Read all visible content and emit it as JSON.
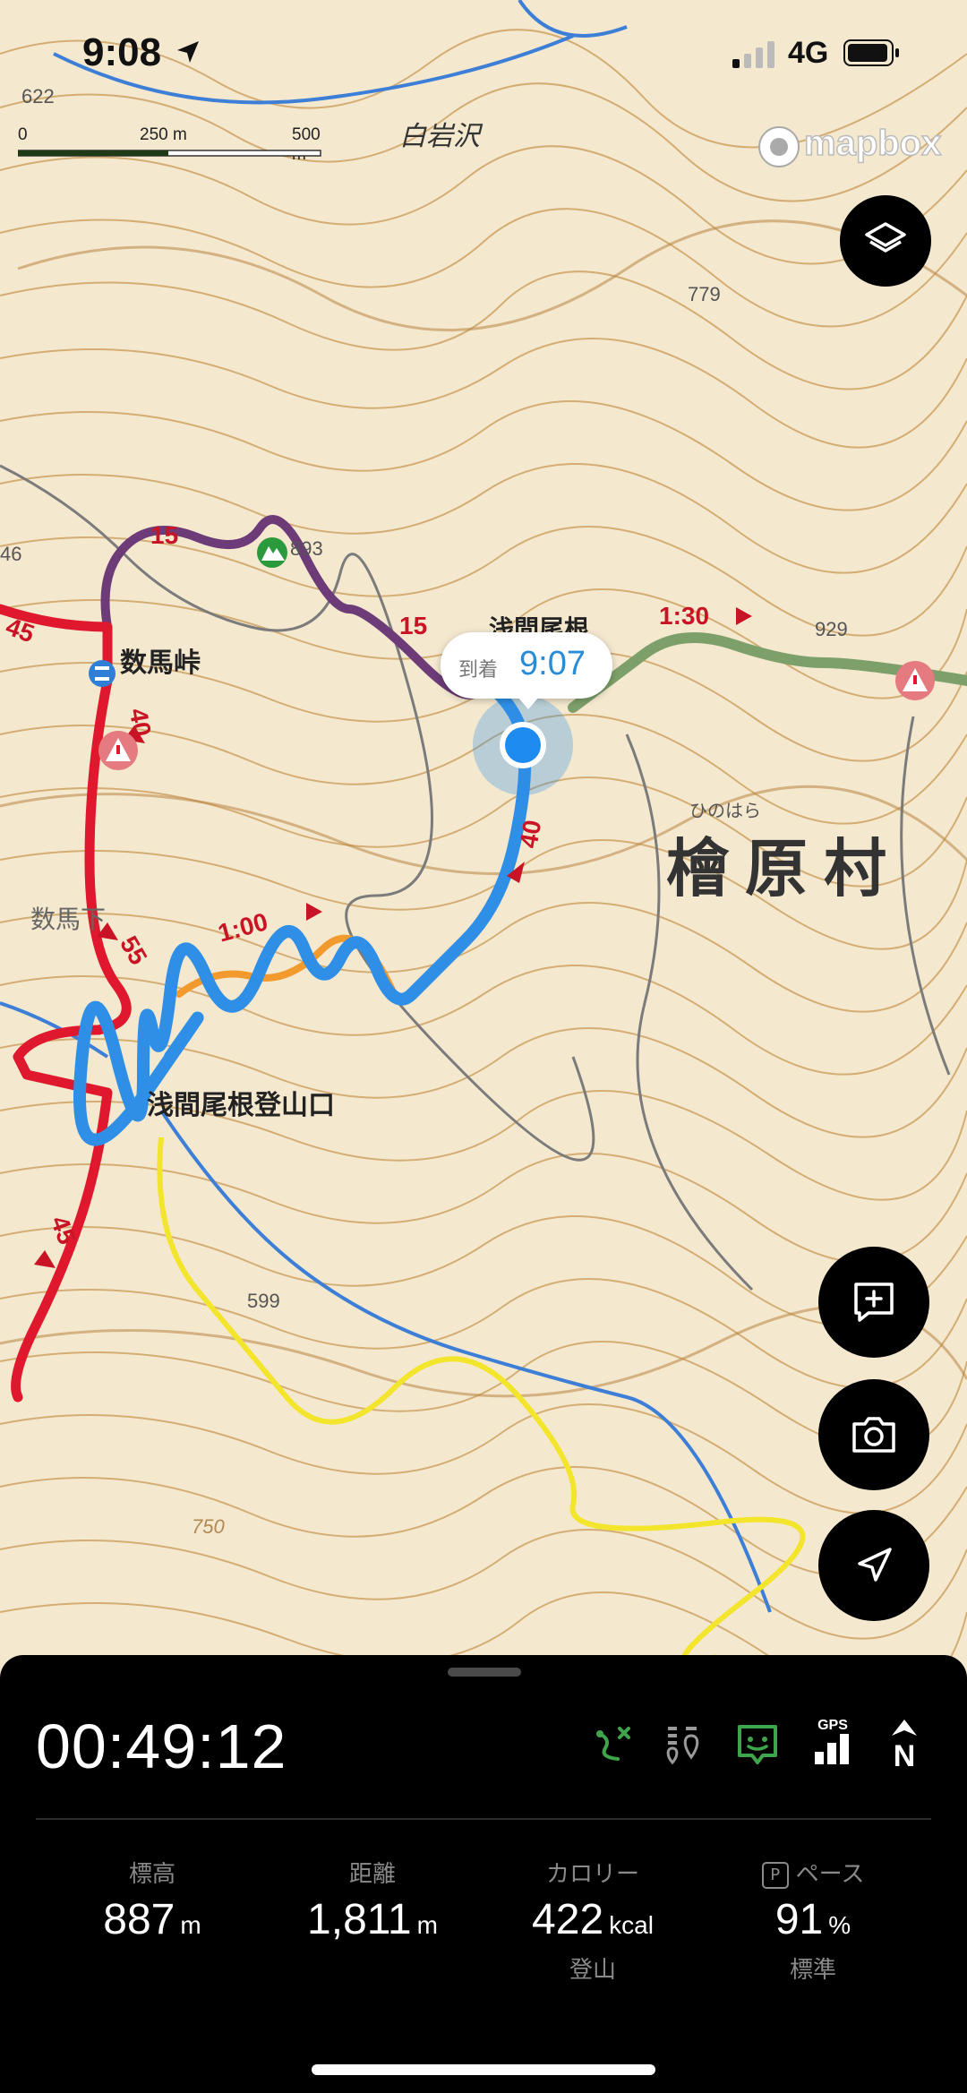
{
  "status_bar": {
    "time": "9:08",
    "network": "4G"
  },
  "scale_bar": {
    "label_0": "0",
    "label_mid": "250 m",
    "label_end": "500 m"
  },
  "attribution": "mapbox",
  "map": {
    "place_labels": [
      {
        "text": "白岩沢",
        "kind": "stream"
      },
      {
        "text": "622",
        "kind": "elevation"
      },
      {
        "text": "779",
        "kind": "elevation"
      },
      {
        "text": "893",
        "kind": "elevation"
      },
      {
        "text": "929",
        "kind": "elevation"
      },
      {
        "text": "599",
        "kind": "elevation"
      },
      {
        "text": "750",
        "kind": "contour"
      },
      {
        "text": "46",
        "kind": "elevation"
      },
      {
        "text": "数馬峠",
        "kind": "pass"
      },
      {
        "text": "数馬下",
        "kind": "place"
      },
      {
        "text": "浅間尾根",
        "kind": "ridge"
      },
      {
        "text": "浅間尾根登山口",
        "kind": "trailhead"
      },
      {
        "text": "ひのはら",
        "kind": "reading"
      },
      {
        "text": "檜原村",
        "kind": "village"
      }
    ],
    "course_times": [
      "15",
      "15",
      "1:30",
      "40",
      "40",
      "55",
      "1:00",
      "45",
      "45"
    ],
    "colors": {
      "recorded_track": "#2f8fe6",
      "planned_route": "#e0182d",
      "alt_route": "#6d3b78",
      "road": "#f2e52c",
      "contour": "#c99a55",
      "stream": "#3d7fd6"
    }
  },
  "arrival_popup": {
    "label": "到着",
    "time": "9:07"
  },
  "buttons": {
    "layers": "layers-icon",
    "add_memo": "add-memo-icon",
    "camera": "camera-icon",
    "locate": "navigate-icon"
  },
  "panel": {
    "elapsed": "00:49:12",
    "status_icons": [
      "route-off-icon",
      "sensor-icon",
      "face-status-icon",
      "gps-signal-icon",
      "north-up-icon"
    ],
    "gps_label": "GPS",
    "stats": [
      {
        "label": "標高",
        "value": "887",
        "unit": "m",
        "sub": ""
      },
      {
        "label": "距離",
        "value": "1,811",
        "unit": "m",
        "sub": ""
      },
      {
        "label": "カロリー",
        "value": "422",
        "unit": "kcal",
        "sub": "登山"
      },
      {
        "label": "ペース",
        "value": "91",
        "unit": "%",
        "sub": "標準",
        "prefix": "P"
      }
    ]
  }
}
